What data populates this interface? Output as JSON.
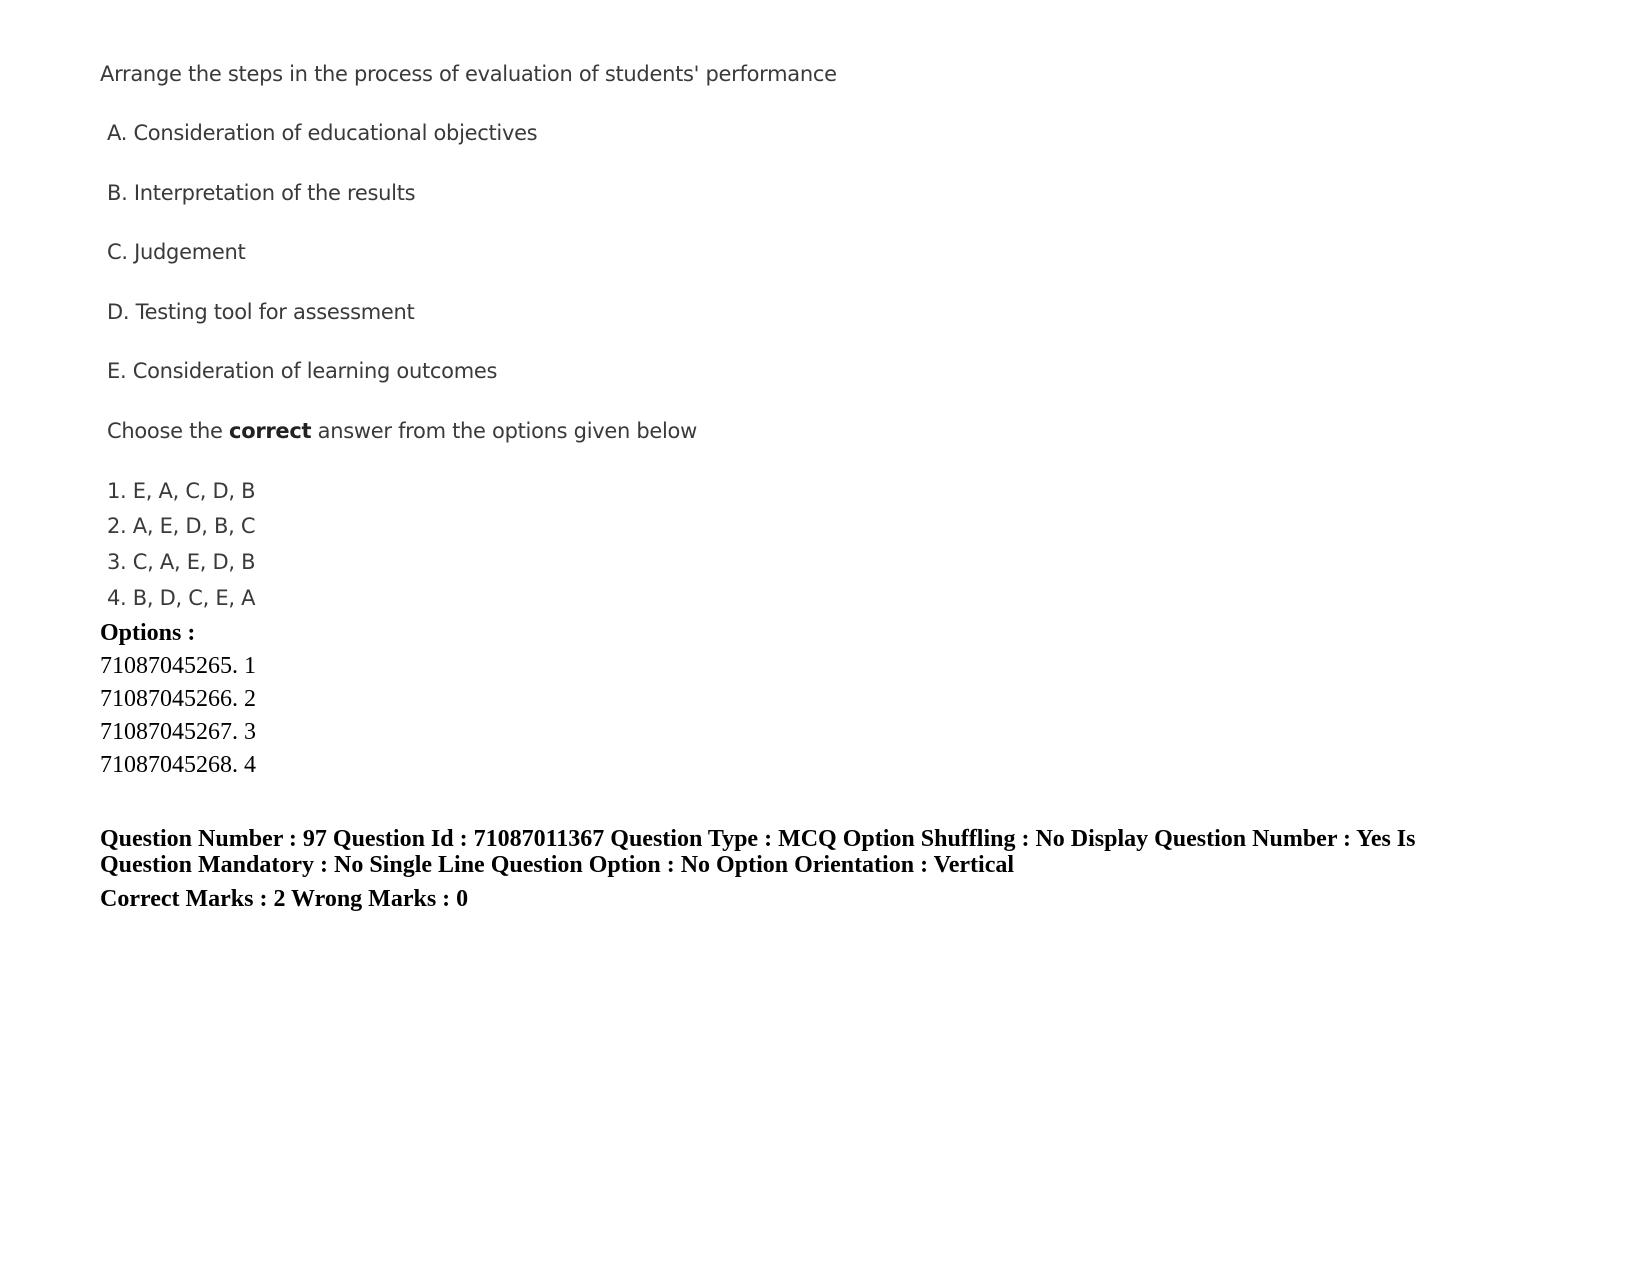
{
  "question": {
    "stem": "Arrange the steps in the process of evaluation of students' performance",
    "statements": [
      "A. Consideration of educational objectives",
      "B. Interpretation of the results",
      "C. Judgement",
      "D. Testing tool for assessment",
      "E. Consideration of learning outcomes"
    ],
    "instruction": {
      "prefix": "Choose the ",
      "emphasis": "correct",
      "suffix": " answer from the options given below"
    },
    "choices": [
      "1. E, A, C, D, B",
      "2. A, E, D, B, C",
      "3. C, A, E, D, B",
      "4. B, D, C, E, A"
    ]
  },
  "options": {
    "heading": "Options :",
    "items": [
      "71087045265. 1",
      "71087045266. 2",
      "71087045267. 3",
      "71087045268. 4"
    ]
  },
  "metadata": {
    "line1": "Question Number : 97 Question Id : 71087011367 Question Type : MCQ Option Shuffling : No Display Question Number : Yes Is",
    "line2": "Question Mandatory : No Single Line Question Option : No Option Orientation : Vertical",
    "line3": "Correct Marks : 2 Wrong Marks : 0"
  }
}
